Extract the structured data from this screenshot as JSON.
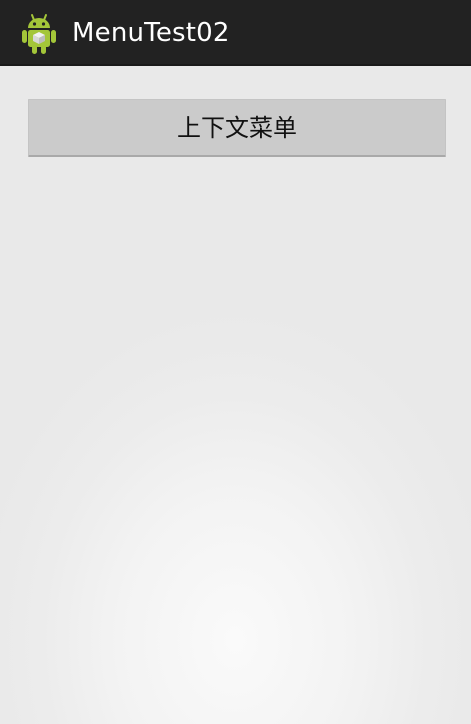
{
  "action_bar": {
    "title": "MenuTest02",
    "icon": "android-robot-icon",
    "background_color": "#222222"
  },
  "main": {
    "context_menu_button_label": "上下文菜单"
  },
  "colors": {
    "icon_green": "#a4c639",
    "button_gray": "#cbcbcb"
  }
}
